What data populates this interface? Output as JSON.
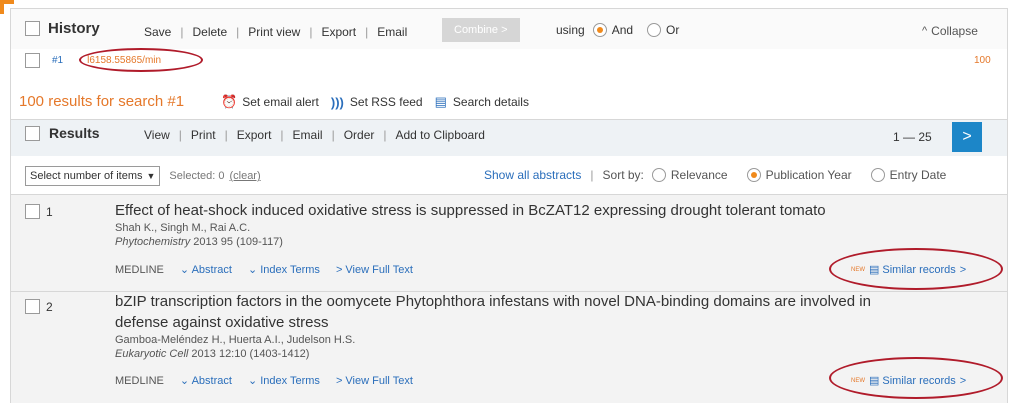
{
  "history": {
    "title": "History",
    "actions": [
      "Save",
      "Delete",
      "Print view",
      "Export",
      "Email"
    ],
    "combine_label": "Combine",
    "using_label": "using",
    "and_label": "And",
    "or_label": "Or",
    "collapse_label": "Collapse",
    "query_id": "#1",
    "query_text": "l6158.55865/min",
    "query_count": "100"
  },
  "results_header": {
    "summary": "100 results for search #1",
    "email_alert": "Set email alert",
    "rss_feed": "Set RSS feed",
    "search_details": "Search details"
  },
  "results_bar": {
    "title": "Results",
    "actions": [
      "View",
      "Print",
      "Export",
      "Email",
      "Order",
      "Add to Clipboard"
    ],
    "range": "1 — 25"
  },
  "toolbar": {
    "select_items": "Select number of items",
    "selected_label": "Selected: 0",
    "clear_label": "(clear)",
    "show_abstracts": "Show all abstracts",
    "sort_by": "Sort by:",
    "sort_relevance": "Relevance",
    "sort_pubyear": "Publication Year",
    "sort_entry": "Entry Date"
  },
  "records": [
    {
      "num": "1",
      "title": "Effect of heat-shock induced oxidative stress is suppressed in BcZAT12 expressing drought tolerant tomato",
      "authors": "Shah K., Singh M., Rai A.C.",
      "journal": "Phytochemistry",
      "citation": "2013 95 (109-117)",
      "source": "MEDLINE",
      "abstract": "Abstract",
      "index_terms": "Index Terms",
      "full_text": "View Full Text",
      "new_badge": "NEW",
      "similar": "Similar records"
    },
    {
      "num": "2",
      "title_line1": "bZIP transcription factors in the oomycete Phytophthora infestans with novel DNA-binding domains are involved in",
      "title_line2": "defense against oxidative stress",
      "authors": "Gamboa-Meléndez H., Huerta A.I., Judelson H.S.",
      "journal": "Eukaryotic Cell",
      "citation": "2013 12:10 (1403-1412)",
      "source": "MEDLINE",
      "abstract": "Abstract",
      "index_terms": "Index Terms",
      "full_text": "View Full Text",
      "new_badge": "NEW",
      "similar": "Similar records"
    }
  ],
  "colors": {
    "accent_orange": "#e5782a",
    "link_blue": "#2a6ebb",
    "button_blue": "#1c86c8",
    "annotation_red": "#b01b2a"
  }
}
